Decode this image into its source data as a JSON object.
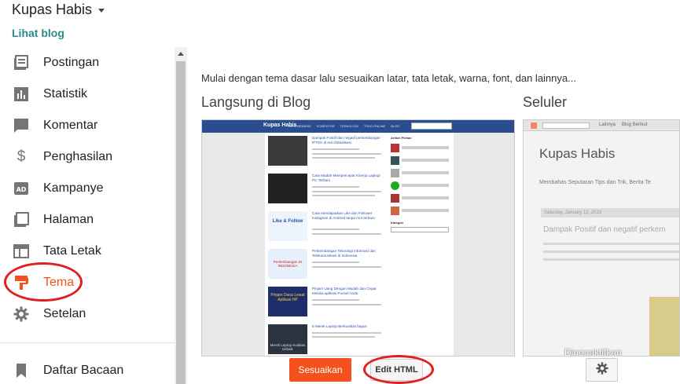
{
  "header": {
    "blog_name": "Kupas Habis",
    "view_blog": "Lihat blog"
  },
  "sidebar": {
    "items": [
      {
        "label": "Postingan",
        "icon": "posts-icon"
      },
      {
        "label": "Statistik",
        "icon": "stats-icon"
      },
      {
        "label": "Komentar",
        "icon": "comment-icon"
      },
      {
        "label": "Penghasilan",
        "icon": "dollar-icon"
      },
      {
        "label": "Kampanye",
        "icon": "ad-icon"
      },
      {
        "label": "Halaman",
        "icon": "pages-icon"
      },
      {
        "label": "Tata Letak",
        "icon": "layout-icon"
      },
      {
        "label": "Tema",
        "icon": "theme-icon",
        "active": true
      },
      {
        "label": "Setelan",
        "icon": "gear-icon"
      }
    ],
    "reading_list": "Daftar Bacaan"
  },
  "main": {
    "intro": "Mulai dengan tema dasar lalu sesuaikan latar, tata letak, warna, font, dan lainnya...",
    "live_heading": "Langsung di Blog",
    "mobile_heading": "Seluler",
    "customize_button": "Sesuaikan",
    "edit_html_button": "Edit HTML"
  },
  "preview": {
    "blog_title": "Kupas Habis",
    "menu": [
      "INFO MENARIK",
      "KOMPUTER",
      "TEKNOLOGI",
      "TOKO ONLINE",
      "BLOG"
    ],
    "posts": [
      "Dampak Positif dan negatif perkembangan IPTEK di era Globalisasi",
      "Cara Mudah Mempercepat Kinerja Laptop/ PC Terbaru",
      "Cara mendapatkan Like dan Follower Instagram di Android tanpa root terbaru",
      "Perkembangan Teknologi Informasi dan Telekomunikasi di Indonesia",
      "Pinjam Uang Dengan Mudah dan Cepat Melalui aplikasi Ponsel Anda",
      "5 Merek Laptop Berkualitas bagus"
    ],
    "side_heading": "Artikel Pilihan",
    "category_heading": "Kategori",
    "thumb_labels": [
      "Like & Follow",
      "Perkembangan DI INDONESIA",
      "Pinjam Dana Lewat Aplikasi HP",
      "Merek Laptop Kualitas terbaik"
    ]
  },
  "mobile": {
    "top_links": [
      "Lainnya",
      "Blog Berikut"
    ],
    "title": "Kupas Habis",
    "subtitle": "Membahas Seputaran Tips dan Trik, Berita Te",
    "date": "Saturday, January 12, 2019",
    "post_title": "Dampak Positif dan negatif perkem",
    "footer_text": "Dinonaktifkan"
  },
  "colors": {
    "accent": "#f4511e",
    "link": "#2b8a8a",
    "annotation": "#e02020"
  }
}
